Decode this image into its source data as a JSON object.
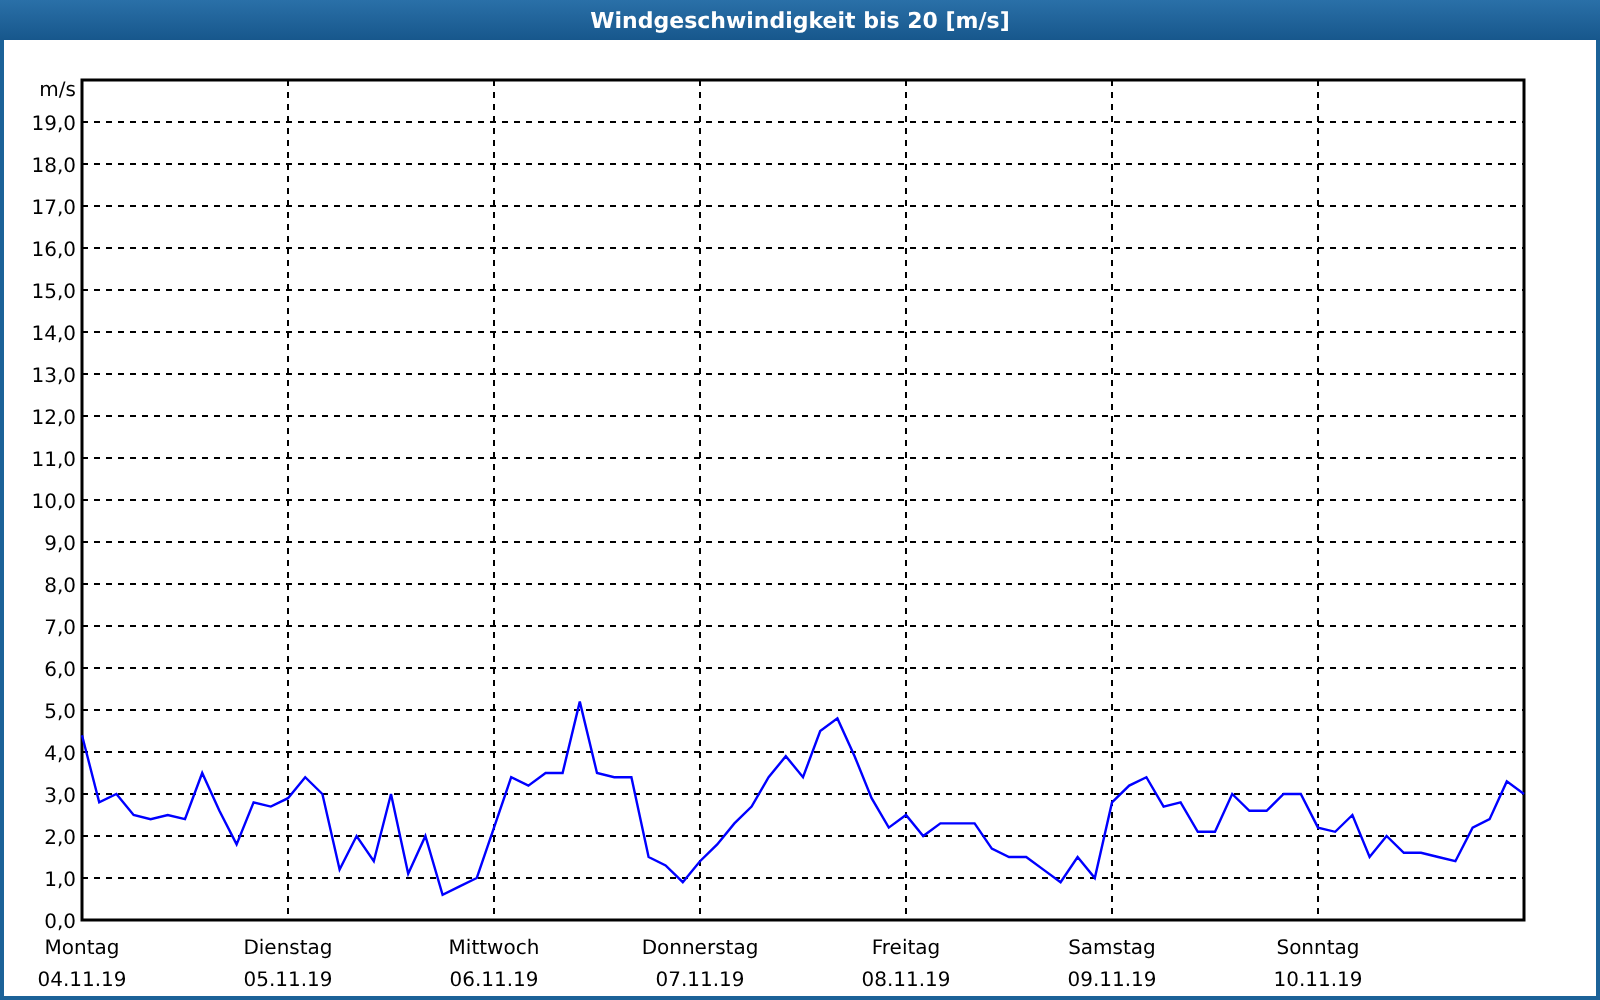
{
  "window": {
    "title": "Windgeschwindigkeit bis 20 [m/s]"
  },
  "chart": {
    "dates": [
      "04.11.19",
      "05.11.19",
      "06.11.19",
      "07.11.19",
      "08.11.19",
      "09.11.19",
      "10.11.19"
    ],
    "chart_data": {
      "type": "line",
      "ylabel": "m/s",
      "ylim": [
        0,
        20
      ],
      "grid": true,
      "categories": [
        "Montag",
        null,
        null,
        null,
        null,
        null,
        null,
        null,
        null,
        null,
        null,
        null,
        "Dienstag",
        null,
        null,
        null,
        null,
        null,
        null,
        null,
        null,
        null,
        null,
        null,
        "Mittwoch",
        null,
        null,
        null,
        null,
        null,
        null,
        null,
        null,
        null,
        null,
        null,
        "Donnerstag",
        null,
        null,
        null,
        null,
        null,
        null,
        null,
        null,
        null,
        null,
        null,
        "Freitag",
        null,
        null,
        null,
        null,
        null,
        null,
        null,
        null,
        null,
        null,
        null,
        "Samstag",
        null,
        null,
        null,
        null,
        null,
        null,
        null,
        null,
        null,
        null,
        null,
        "Sonntag",
        null,
        null,
        null,
        null,
        null,
        null,
        null,
        null,
        null,
        null,
        null,
        null
      ],
      "series": [
        {
          "color": "#0000ff",
          "values": [
            4.4,
            2.8,
            3.0,
            2.5,
            2.4,
            2.5,
            2.4,
            3.5,
            2.6,
            1.8,
            2.8,
            2.7,
            2.9,
            3.4,
            3.0,
            1.2,
            2.0,
            1.4,
            3.0,
            1.1,
            2.0,
            0.6,
            0.8,
            1.0,
            2.2,
            3.4,
            3.2,
            3.5,
            3.5,
            5.2,
            3.5,
            3.4,
            3.4,
            1.5,
            1.3,
            0.9,
            1.4,
            1.8,
            2.3,
            2.7,
            3.4,
            3.9,
            3.4,
            4.5,
            4.8,
            3.9,
            2.9,
            2.2,
            2.5,
            2.0,
            2.3,
            2.3,
            2.3,
            1.7,
            1.5,
            1.5,
            1.2,
            0.9,
            1.5,
            1.0,
            2.8,
            3.2,
            3.4,
            2.7,
            2.8,
            2.1,
            2.1,
            3.0,
            2.6,
            2.6,
            3.0,
            3.0,
            2.2,
            2.1,
            2.5,
            1.5,
            2.0,
            1.6,
            1.6,
            1.5,
            1.4,
            2.2,
            2.4,
            3.3,
            3.0
          ]
        }
      ],
      "yticks": [
        {
          "value": 0,
          "label": "0,0"
        },
        {
          "value": 1,
          "label": "1,0"
        },
        {
          "value": 2,
          "label": "2,0"
        },
        {
          "value": 3,
          "label": "3,0"
        },
        {
          "value": 4,
          "label": "4,0"
        },
        {
          "value": 5,
          "label": "5,0"
        },
        {
          "value": 6,
          "label": "6,0"
        },
        {
          "value": 7,
          "label": "7,0"
        },
        {
          "value": 8,
          "label": "8,0"
        },
        {
          "value": 9,
          "label": "9,0"
        },
        {
          "value": 10,
          "label": "10,0"
        },
        {
          "value": 11,
          "label": "11,0"
        },
        {
          "value": 12,
          "label": "12,0"
        },
        {
          "value": 13,
          "label": "13,0"
        },
        {
          "value": 14,
          "label": "14,0"
        },
        {
          "value": 15,
          "label": "15,0"
        },
        {
          "value": 16,
          "label": "16,0"
        },
        {
          "value": 17,
          "label": "17,0"
        },
        {
          "value": 18,
          "label": "18,0"
        },
        {
          "value": 19,
          "label": "19,0"
        }
      ]
    }
  }
}
